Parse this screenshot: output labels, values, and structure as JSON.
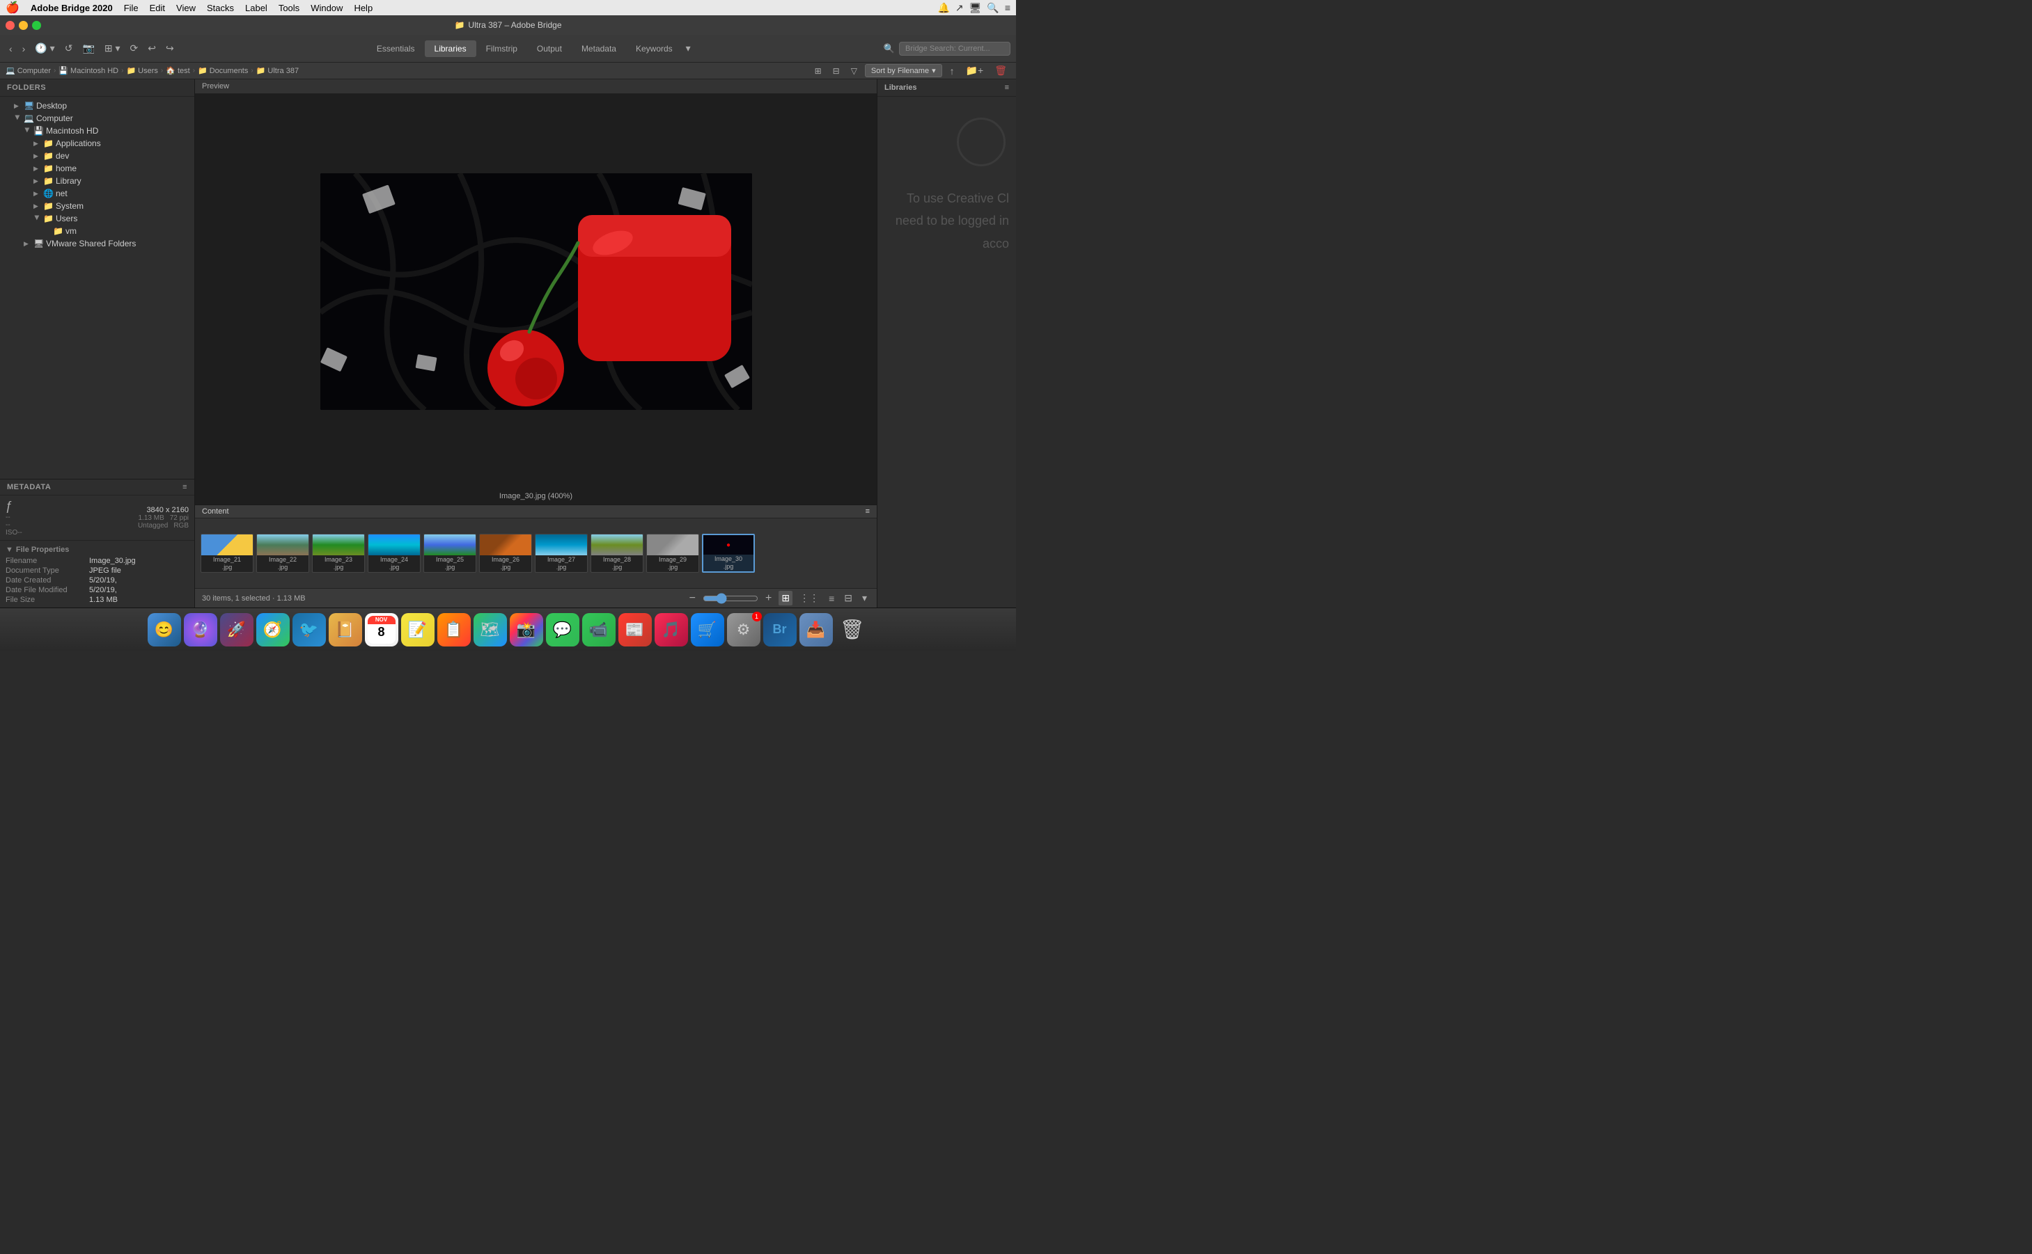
{
  "menubar": {
    "apple": "🍎",
    "app_name": "Adobe Bridge 2020",
    "items": [
      "File",
      "Edit",
      "View",
      "Stacks",
      "Label",
      "Tools",
      "Window",
      "Help"
    ],
    "right_icons": [
      "🔔",
      "🔁",
      "📺",
      "🔍",
      "≡"
    ]
  },
  "titlebar": {
    "title": "Ultra 387 – Adobe Bridge",
    "folder_icon": "📁"
  },
  "toolbar": {
    "back": "‹",
    "forward": "›",
    "nav_buttons": [
      "↺",
      "⤶",
      "⊞",
      "⟳"
    ],
    "workspaces": [
      "Essentials",
      "Libraries",
      "Filmstrip",
      "Output",
      "Metadata",
      "Keywords"
    ],
    "active_workspace": "Libraries",
    "search_placeholder": "Bridge Search: Current..."
  },
  "breadcrumb": {
    "items": [
      {
        "label": "Computer",
        "icon": "💻"
      },
      {
        "label": "Macintosh HD",
        "icon": "💾"
      },
      {
        "label": "Users",
        "icon": "📁"
      },
      {
        "label": "test",
        "icon": "🏠"
      },
      {
        "label": "Documents",
        "icon": "📁"
      },
      {
        "label": "Ultra 387",
        "icon": "📁"
      }
    ],
    "sort_label": "Sort by Filename"
  },
  "folders_panel": {
    "title": "Folders",
    "items": [
      {
        "label": "Desktop",
        "icon": "🖥",
        "indent": 1,
        "expanded": false
      },
      {
        "label": "Computer",
        "icon": "💻",
        "indent": 1,
        "expanded": true
      },
      {
        "label": "Macintosh HD",
        "icon": "💾",
        "indent": 2,
        "expanded": true
      },
      {
        "label": "Applications",
        "icon": "📁",
        "indent": 3,
        "expanded": false
      },
      {
        "label": "dev",
        "icon": "📁",
        "indent": 3,
        "expanded": false
      },
      {
        "label": "home",
        "icon": "📁",
        "indent": 3,
        "expanded": false
      },
      {
        "label": "Library",
        "icon": "📁",
        "indent": 3,
        "expanded": false
      },
      {
        "label": "net",
        "icon": "🌐",
        "indent": 3,
        "expanded": false
      },
      {
        "label": "System",
        "icon": "📁",
        "indent": 3,
        "expanded": false
      },
      {
        "label": "Users",
        "icon": "📁",
        "indent": 3,
        "expanded": true
      },
      {
        "label": "vm",
        "icon": "📁",
        "indent": 4,
        "expanded": false
      },
      {
        "label": "VMware Shared Folders",
        "icon": "🖥",
        "indent": 2,
        "expanded": false
      }
    ]
  },
  "metadata_panel": {
    "title": "Metadata",
    "fi_label": "fi",
    "camera_info": {
      "aperture": "--",
      "shutter": "--",
      "iso_label": "ISO--"
    },
    "dimensions": "3840 x 2160",
    "file_size": "1.13 MB",
    "ppi": "72 ppi",
    "untagged": "Untagged",
    "color_mode": "RGB",
    "file_properties_label": "File Properties",
    "filename_label": "Filename",
    "filename_value": "Image_30.jpg",
    "doctype_label": "Document Type",
    "doctype_value": "JPEG file",
    "date_created_label": "Date Created",
    "date_created_value": "5/20/19,",
    "date_modified_label": "Date File Modified",
    "date_modified_value": "5/20/19,",
    "filesize_label": "File Size",
    "filesize_value": "1.13 MB"
  },
  "preview": {
    "header": "Preview",
    "caption": "Image_30.jpg (400%)",
    "image_description": "Dark abstract scene with red cherry and red cube on black background"
  },
  "content": {
    "header": "Content",
    "total_items": "30 items, 1 selected · 1.13 MB",
    "thumbnails": [
      {
        "label": "Image_21\n.jpg",
        "style": "beach",
        "selected": false
      },
      {
        "label": "Image_22\n.jpg",
        "style": "mountain",
        "selected": false
      },
      {
        "label": "Image_23\n.jpg",
        "style": "forest",
        "selected": false
      },
      {
        "label": "Image_24\n.jpg",
        "style": "ocean",
        "selected": false
      },
      {
        "label": "Image_25\n.jpg",
        "style": "river",
        "selected": false
      },
      {
        "label": "Image_26\n.jpg",
        "style": "wood",
        "selected": false
      },
      {
        "label": "Image_27\n.jpg",
        "style": "underwater",
        "selected": false
      },
      {
        "label": "Image_28\n.jpg",
        "style": "elephant",
        "selected": false
      },
      {
        "label": "Image_29\n.jpg",
        "style": "gray",
        "selected": false
      },
      {
        "label": "Image_30\n.jpg",
        "style": "dark",
        "selected": true
      }
    ]
  },
  "libraries_panel": {
    "title": "Libraries",
    "message": "To use Creative Cl...\nneed to be logged in...\naccc..."
  },
  "status_bar": {
    "text": "30 items, 1 selected · 1.13 MB",
    "zoom_minus": "−",
    "zoom_plus": "+",
    "view_grid": "⊞",
    "view_grid2": "⋮⋮",
    "view_list": "≡",
    "view_details": "⊟"
  },
  "dock": {
    "items": [
      {
        "icon": "🔵",
        "label": "finder",
        "color": "#1e7fd4"
      },
      {
        "icon": "🔮",
        "label": "siri",
        "color": "#bf5af2"
      },
      {
        "icon": "🚀",
        "label": "launchpad",
        "color": "#4a90d9"
      },
      {
        "icon": "🧭",
        "label": "safari",
        "color": "#1e90ff"
      },
      {
        "icon": "🐦",
        "label": "tweetbot",
        "color": "#4a90d9"
      },
      {
        "icon": "📅",
        "label": "calendar-notes",
        "color": "#ff6b35"
      },
      {
        "icon": "🗓",
        "label": "calendar",
        "color": "#ff3b30"
      },
      {
        "icon": "📝",
        "label": "notes",
        "color": "#f5c842"
      },
      {
        "icon": "🎨",
        "label": "reminders",
        "color": "#ff3b30"
      },
      {
        "icon": "🗺",
        "label": "maps",
        "color": "#34c759"
      },
      {
        "icon": "📸",
        "label": "photos",
        "color": "#ff9500"
      },
      {
        "icon": "💬",
        "label": "messages",
        "color": "#34c759"
      },
      {
        "icon": "🤝",
        "label": "facetime",
        "color": "#34c759"
      },
      {
        "icon": "📰",
        "label": "news",
        "color": "#ff3b30"
      },
      {
        "icon": "🎵",
        "label": "music",
        "color": "#fa2d55"
      },
      {
        "icon": "🛒",
        "label": "appstore",
        "color": "#1e90ff"
      },
      {
        "icon": "⚙",
        "label": "systemprefs",
        "color": "#888",
        "badge": "1"
      },
      {
        "icon": "Br",
        "label": "adobebridge",
        "color": "#1e5a8a"
      },
      {
        "icon": "📥",
        "label": "downloads",
        "color": "#4a90d9"
      },
      {
        "icon": "🗑",
        "label": "trash",
        "color": "#888"
      }
    ]
  }
}
